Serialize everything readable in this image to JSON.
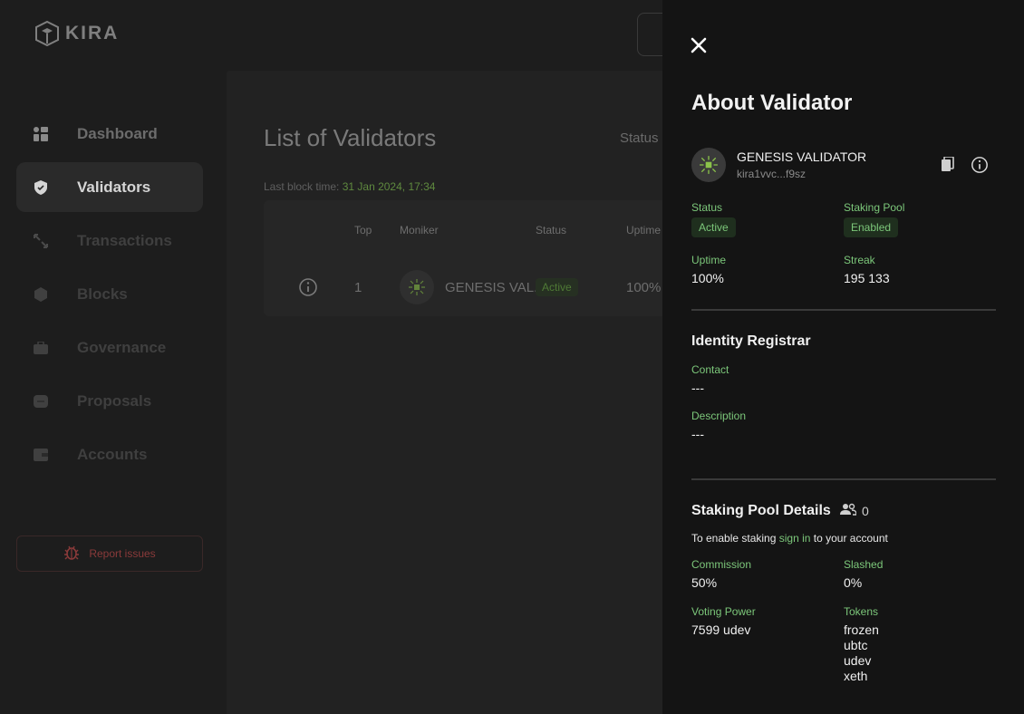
{
  "brand": {
    "name": "KIRA"
  },
  "sidebar": {
    "items": [
      {
        "label": "Dashboard",
        "icon": "dashboard-icon",
        "active": false
      },
      {
        "label": "Validators",
        "icon": "shield-icon",
        "active": true
      },
      {
        "label": "Transactions",
        "icon": "arrows-icon",
        "active": false
      },
      {
        "label": "Blocks",
        "icon": "cube-icon",
        "active": false
      },
      {
        "label": "Governance",
        "icon": "briefcase-icon",
        "active": false
      },
      {
        "label": "Proposals",
        "icon": "proposal-icon",
        "active": false
      },
      {
        "label": "Accounts",
        "icon": "wallet-icon",
        "active": false
      }
    ],
    "report_label": "Report issues"
  },
  "main": {
    "title": "List of Validators",
    "status_filter_label": "Status",
    "last_block_label": "Last block time:",
    "last_block_value": "31 Jan 2024, 17:34",
    "table": {
      "headers": [
        "Top",
        "Moniker",
        "Status",
        "Uptime"
      ],
      "rows": [
        {
          "top": "1",
          "moniker": "GENESIS VAL...",
          "status": "Active",
          "uptime": "100%"
        }
      ]
    }
  },
  "drawer": {
    "title": "About Validator",
    "validator_name": "GENESIS VALIDATOR",
    "validator_address": "kira1vvc...f9sz",
    "status_label": "Status",
    "status_value": "Active",
    "staking_pool_label": "Staking Pool",
    "staking_pool_value": "Enabled",
    "uptime_label": "Uptime",
    "uptime_value": "100%",
    "streak_label": "Streak",
    "streak_value": "195 133",
    "identity_title": "Identity Registrar",
    "contact_label": "Contact",
    "contact_value": "---",
    "description_label": "Description",
    "description_value": "---",
    "staking_title": "Staking Pool Details",
    "delegators_count": "0",
    "enable_text_before": "To enable staking",
    "enable_link": "sign in",
    "enable_text_after": "to your account",
    "commission_label": "Commission",
    "commission_value": "50%",
    "slashed_label": "Slashed",
    "slashed_value": "0%",
    "voting_power_label": "Voting Power",
    "voting_power_value": "7599 udev",
    "tokens_label": "Tokens",
    "tokens": [
      "frozen",
      "ubtc",
      "udev",
      "xeth"
    ]
  },
  "colors": {
    "accent": "#7cc77a",
    "background": "#1d1d1d",
    "drawer": "#141414"
  }
}
